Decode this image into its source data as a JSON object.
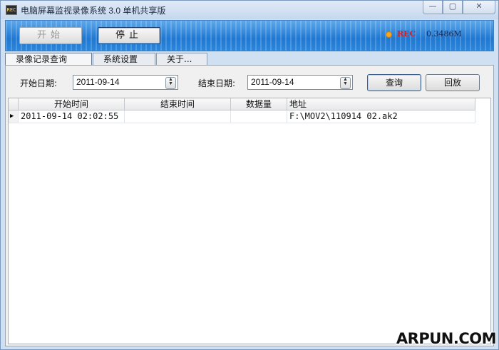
{
  "window": {
    "title": "电脑屏幕监视录像系统 3.0 单机共享版",
    "app_icon_text": "REC",
    "minimize_glyph": "—",
    "maximize_glyph": "▢",
    "close_glyph": "✕"
  },
  "toolbar": {
    "start_label": "开始",
    "stop_label": "停止",
    "rec_label": "REC",
    "rec_size": "0.3486M",
    "rec_dot_color": "#f6a623"
  },
  "tabs": [
    {
      "label": "录像记录查询",
      "active": true
    },
    {
      "label": "系统设置",
      "active": false
    },
    {
      "label": "关于...",
      "active": false
    }
  ],
  "filter": {
    "start_date_label": "开始日期:",
    "start_date_value": "2011-09-14",
    "end_date_label": "结束日期:",
    "end_date_value": "2011-09-14",
    "query_label": "查询",
    "playback_label": "回放"
  },
  "grid": {
    "columns": [
      "开始时间",
      "结束时间",
      "数据量",
      "地址"
    ],
    "rows": [
      {
        "indicator": "▶",
        "start": "2011-09-14 02:02:55",
        "end": "",
        "size": "",
        "address": "F:\\MOV2\\110914 02.ak2"
      }
    ]
  },
  "watermark": "ARPUN.COM"
}
